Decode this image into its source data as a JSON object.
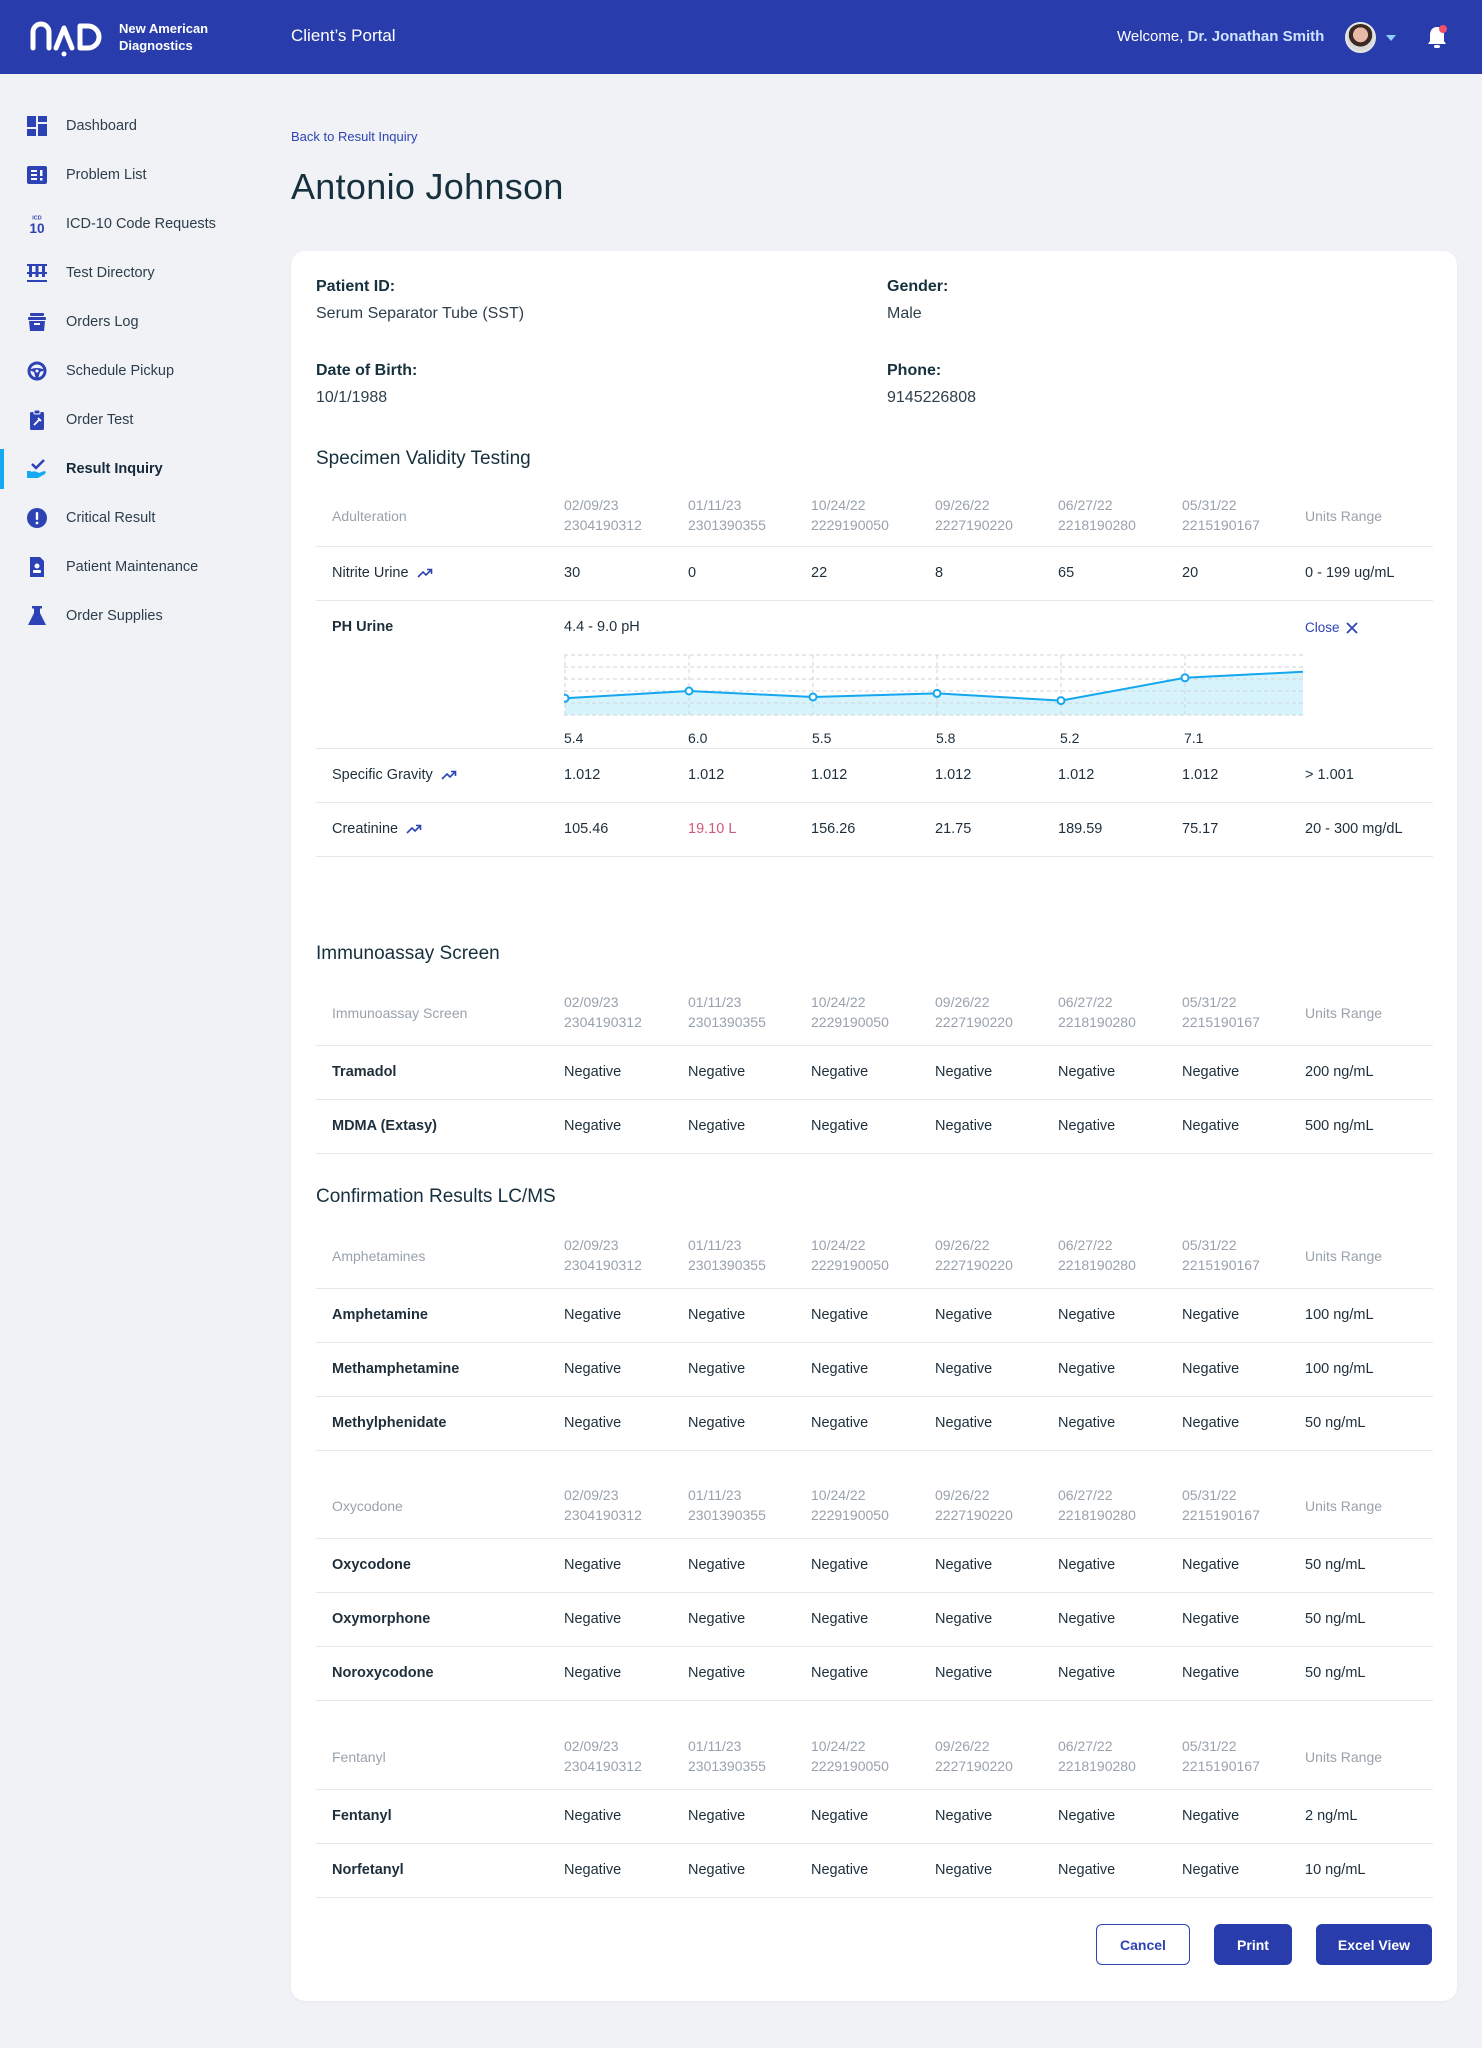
{
  "header": {
    "brand_line1": "New American",
    "brand_line2": "Diagnostics",
    "portal_title": "Client’s Portal",
    "welcome_prefix": "Welcome, ",
    "user_name": "Dr. Jonathan Smith",
    "notification_badge": true
  },
  "sidebar": {
    "items": [
      {
        "label": "Dashboard",
        "icon": "dashboard-icon"
      },
      {
        "label": "Problem List",
        "icon": "problem-list-icon"
      },
      {
        "label": "ICD-10 Code Requests",
        "icon": "icd10-icon"
      },
      {
        "label": "Test Directory",
        "icon": "test-tubes-icon"
      },
      {
        "label": "Orders Log",
        "icon": "archive-box-icon"
      },
      {
        "label": "Schedule Pickup",
        "icon": "steering-wheel-icon"
      },
      {
        "label": "Order Test",
        "icon": "clipboard-icon"
      },
      {
        "label": "Result Inquiry",
        "icon": "hand-check-icon",
        "active": true
      },
      {
        "label": "Critical Result",
        "icon": "alert-circle-icon"
      },
      {
        "label": "Patient Maintenance",
        "icon": "patient-file-icon"
      },
      {
        "label": "Order Supplies",
        "icon": "flask-icon"
      }
    ]
  },
  "page": {
    "back_link": "Back to Result Inquiry",
    "title": "Antonio Johnson"
  },
  "patient": {
    "patient_id_label": "Patient ID:",
    "patient_id_value": "Serum Separator Tube (SST)",
    "gender_label": "Gender:",
    "gender_value": "Male",
    "dob_label": "Date of Birth:",
    "dob_value": "10/1/1988",
    "phone_label": "Phone:",
    "phone_value": "9145226808"
  },
  "columns": {
    "dates": [
      "02/09/23",
      "01/11/23",
      "10/24/22",
      "09/26/22",
      "06/27/22",
      "05/31/22"
    ],
    "ids": [
      "2304190312",
      "2301390355",
      "2229190050",
      "2227190220",
      "2218190280",
      "2215190167"
    ],
    "units_header": "Units Range"
  },
  "specimen": {
    "title": "Specimen Validity Testing",
    "group_header": "Adulteration",
    "nitrite": {
      "name": "Nitrite Urine",
      "values": [
        "30",
        "0",
        "22",
        "8",
        "65",
        "20"
      ],
      "range": "0 - 199 ug/mL"
    },
    "ph": {
      "name": "PH Urine",
      "range": "4.4 - 9.0 pH",
      "close_label": "Close",
      "value_labels": [
        "5.4",
        "6.0",
        "5.5",
        "5.8",
        "5.2",
        "7.1"
      ]
    },
    "gravity": {
      "name": "Specific Gravity",
      "values": [
        "1.012",
        "1.012",
        "1.012",
        "1.012",
        "1.012",
        "1.012"
      ],
      "range": "> 1.001"
    },
    "creatinine": {
      "name": "Creatinine",
      "values": [
        "105.46",
        "19.10 L",
        "156.26",
        "21.75",
        "189.59",
        "75.17"
      ],
      "range": "20 - 300 mg/dL",
      "flagged_index": 1
    }
  },
  "chart_data": {
    "type": "area",
    "title": "PH Urine",
    "subtitle": "4.4 - 9.0 pH",
    "x": [
      "02/09/23",
      "01/11/23",
      "10/24/22",
      "09/26/22",
      "06/27/22",
      "05/31/22"
    ],
    "series": [
      {
        "name": "PH Urine",
        "values": [
          5.4,
          6.0,
          5.5,
          5.8,
          5.2,
          7.1
        ],
        "trailing_value": 7.6
      }
    ],
    "ylim": [
      4.0,
      9.0
    ],
    "grid": true,
    "line_color": "#14a7ef",
    "fill_color": "#d7f4fd"
  },
  "immunoassay": {
    "title": "Immunoassay Screen",
    "group_header": "Immunoassay Screen",
    "rows": [
      {
        "name": "Tramadol",
        "values": [
          "Negative",
          "Negative",
          "Negative",
          "Negative",
          "Negative",
          "Negative"
        ],
        "range": "200 ng/mL"
      },
      {
        "name": "MDMA (Extasy)",
        "values": [
          "Negative",
          "Negative",
          "Negative",
          "Negative",
          "Negative",
          "Negative"
        ],
        "range": "500 ng/mL"
      }
    ]
  },
  "confirmation": {
    "title": "Confirmation Results LC/MS",
    "groups": [
      {
        "header": "Amphetamines",
        "rows": [
          {
            "name": "Amphetamine",
            "values": [
              "Negative",
              "Negative",
              "Negative",
              "Negative",
              "Negative",
              "Negative"
            ],
            "range": "100 ng/mL"
          },
          {
            "name": "Methamphetamine",
            "values": [
              "Negative",
              "Negative",
              "Negative",
              "Negative",
              "Negative",
              "Negative"
            ],
            "range": "100 ng/mL"
          },
          {
            "name": "Methylphenidate",
            "values": [
              "Negative",
              "Negative",
              "Negative",
              "Negative",
              "Negative",
              "Negative"
            ],
            "range": "50 ng/mL"
          }
        ]
      },
      {
        "header": "Oxycodone",
        "rows": [
          {
            "name": "Oxycodone",
            "values": [
              "Negative",
              "Negative",
              "Negative",
              "Negative",
              "Negative",
              "Negative"
            ],
            "range": "50 ng/mL"
          },
          {
            "name": "Oxymorphone",
            "values": [
              "Negative",
              "Negative",
              "Negative",
              "Negative",
              "Negative",
              "Negative"
            ],
            "range": "50 ng/mL"
          },
          {
            "name": "Noroxycodone",
            "values": [
              "Negative",
              "Negative",
              "Negative",
              "Negative",
              "Negative",
              "Negative"
            ],
            "range": "50 ng/mL"
          }
        ]
      },
      {
        "header": "Fentanyl",
        "rows": [
          {
            "name": "Fentanyl",
            "values": [
              "Negative",
              "Negative",
              "Negative",
              "Negative",
              "Negative",
              "Negative"
            ],
            "range": "2 ng/mL"
          },
          {
            "name": "Norfetanyl",
            "values": [
              "Negative",
              "Negative",
              "Negative",
              "Negative",
              "Negative",
              "Negative"
            ],
            "range": "10 ng/mL"
          }
        ]
      }
    ]
  },
  "actions": {
    "cancel": "Cancel",
    "print": "Print",
    "excel": "Excel View"
  }
}
